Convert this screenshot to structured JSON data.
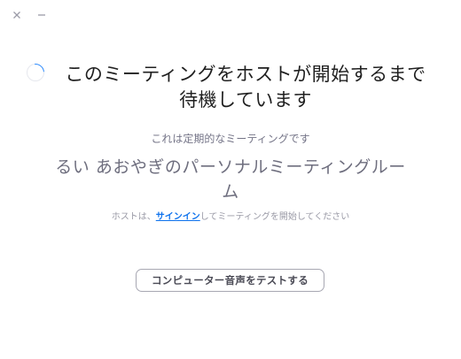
{
  "window": {
    "close_icon": "close-icon",
    "minimize_icon": "minimize-icon"
  },
  "status": {
    "title_line1": "このミーティングをホストが開始するまで",
    "title_line2": "待機しています",
    "subtitle": "これは定期的なミーティングです"
  },
  "meeting": {
    "name": "るい あおやぎのパーソナルミーティングルーム"
  },
  "host_message": {
    "prefix": "ホストは、",
    "link_label": "サインイン",
    "suffix": "してミーティングを開始してください"
  },
  "actions": {
    "test_audio_label": "コンピューター音声をテストする"
  },
  "colors": {
    "accent": "#0e72ed",
    "spinner": "#2d8cff"
  }
}
